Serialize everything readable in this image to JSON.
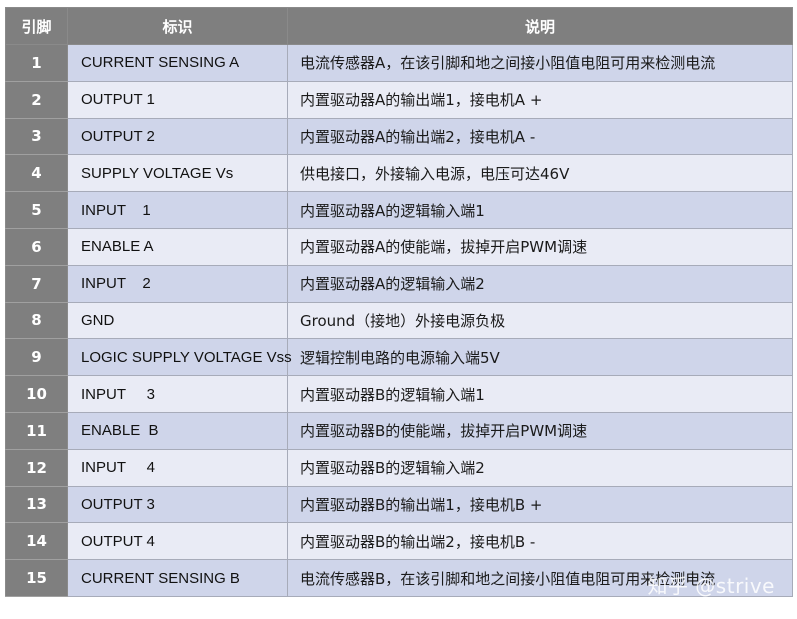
{
  "table": {
    "headers": [
      "引脚",
      "标识",
      "说明"
    ],
    "rows": [
      {
        "pin": "1",
        "id": "CURRENT SENSING A",
        "desc": "电流传感器A，在该引脚和地之间接小阻值电阻可用来检测电流"
      },
      {
        "pin": "2",
        "id": "OUTPUT 1",
        "desc": "内置驱动器A的输出端1，接电机A +"
      },
      {
        "pin": "3",
        "id": "OUTPUT 2",
        "desc": "内置驱动器A的输出端2，接电机A -"
      },
      {
        "pin": "4",
        "id": "SUPPLY VOLTAGE Vs",
        "desc": "供电接口，外接输入电源，电压可达46V"
      },
      {
        "pin": "5",
        "id": "INPUT    1",
        "desc": "内置驱动器A的逻辑输入端1"
      },
      {
        "pin": "6",
        "id": "ENABLE A",
        "desc": "内置驱动器A的使能端，拔掉开启PWM调速"
      },
      {
        "pin": "7",
        "id": "INPUT    2",
        "desc": "内置驱动器A的逻辑输入端2"
      },
      {
        "pin": "8",
        "id": "GND",
        "desc": "Ground（接地）外接电源负极"
      },
      {
        "pin": "9",
        "id": "LOGIC SUPPLY VOLTAGE Vss",
        "desc": "逻辑控制电路的电源输入端5V"
      },
      {
        "pin": "10",
        "id": "INPUT     3",
        "desc": "内置驱动器B的逻辑输入端1"
      },
      {
        "pin": "11",
        "id": "ENABLE  B",
        "desc": "内置驱动器B的使能端，拔掉开启PWM调速"
      },
      {
        "pin": "12",
        "id": "INPUT     4",
        "desc": "内置驱动器B的逻辑输入端2"
      },
      {
        "pin": "13",
        "id": "OUTPUT 3",
        "desc": "内置驱动器B的输出端1，接电机B +"
      },
      {
        "pin": "14",
        "id": "OUTPUT 4",
        "desc": "内置驱动器B的输出端2，接电机B -"
      },
      {
        "pin": "15",
        "id": "CURRENT SENSING B",
        "desc": "电流传感器B，在该引脚和地之间接小阻值电阻可用来检测电流"
      }
    ]
  },
  "watermark": "知乎 @strive",
  "colors": {
    "header_bg": "#7f7f7f",
    "row_odd": "#cfd5ea",
    "row_even": "#e9ebf5"
  }
}
